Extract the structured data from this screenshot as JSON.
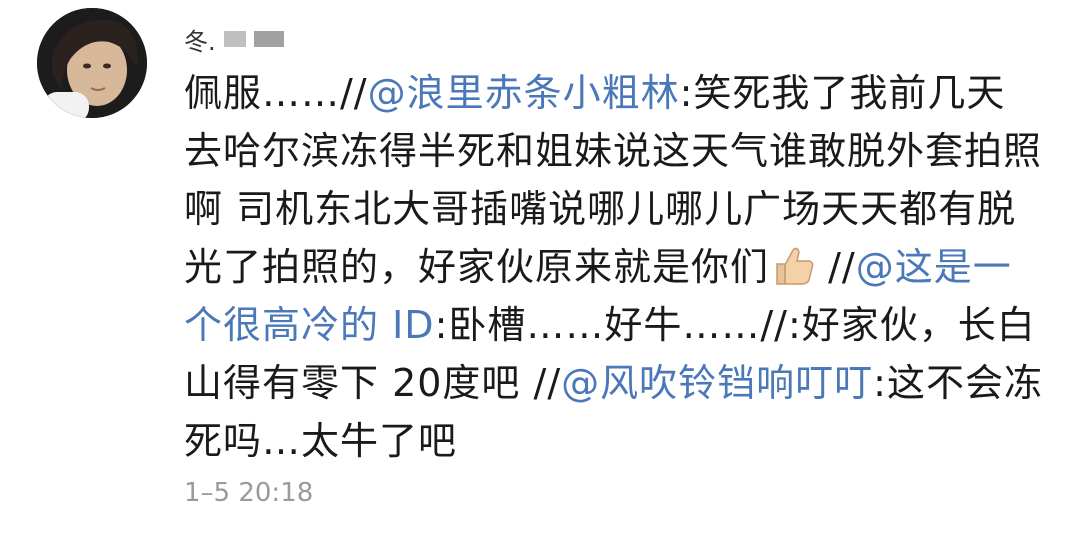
{
  "comment": {
    "username": "冬.",
    "segments": {
      "s1": "佩服……//",
      "m1": "@浪里赤条小粗林",
      "s2": ":笑死我了我前几天去哈尔滨冻得半死和姐妹说这天气谁敢脱外套拍照啊 司机东北大哥插嘴说哪儿哪儿广场天天都有脱光了拍照的，好家伙原来就是你们",
      "s3": " //",
      "m2": "@这是一个很高冷的 ID",
      "s4": ":卧槽……好牛……//:好家伙，长白山得有零下 20度吧 //",
      "m3": "@风吹铃铛响叮叮",
      "s5": ":这不会冻死吗…太牛了吧"
    },
    "timestamp": "1–5 20:18"
  },
  "colors": {
    "mention": "#4a78b8",
    "text": "#1a1a1a",
    "timestamp": "#9a9a9a"
  },
  "icons": {
    "avatar": "avatar",
    "thumbs_up": "thumbs-up-icon"
  }
}
